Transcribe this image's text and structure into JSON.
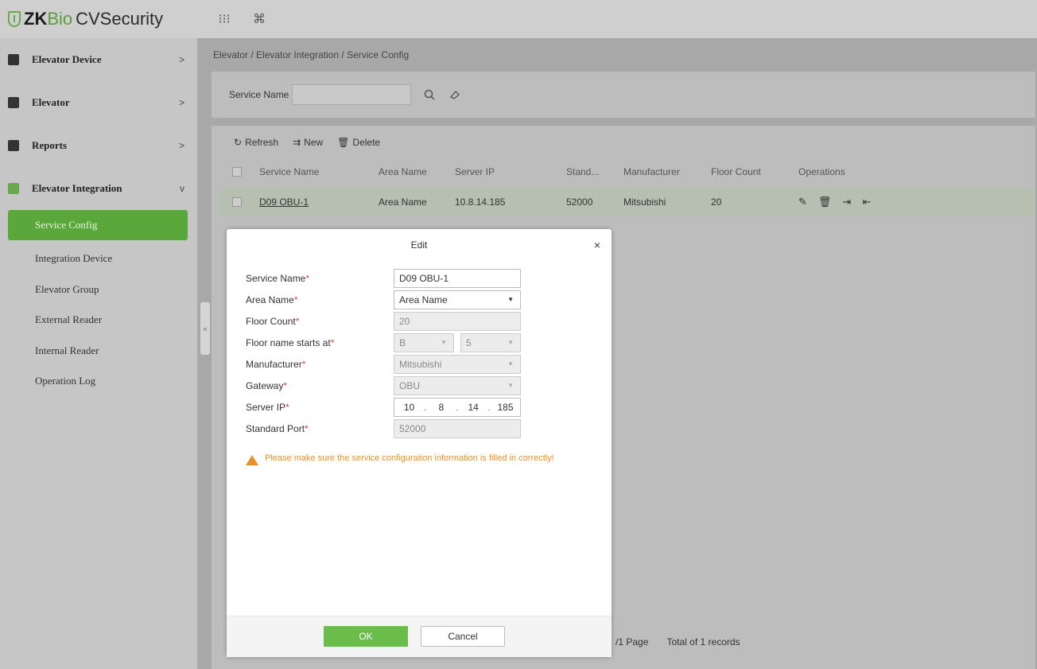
{
  "app": {
    "logo_zk": "ZK",
    "logo_bio": "Bio",
    "logo_rest": "CVSecurity",
    "top_icons": [
      "grid-icon",
      "command-icon"
    ]
  },
  "sidebar": {
    "items": [
      {
        "label": "Elevator Device",
        "icon": "elevator-device-icon",
        "chevron": ">"
      },
      {
        "label": "Elevator",
        "icon": "elevator-icon",
        "chevron": ">"
      },
      {
        "label": "Reports",
        "icon": "reports-icon",
        "chevron": ">"
      },
      {
        "label": "Elevator Integration",
        "icon": "elevator-integration-icon",
        "chevron": "v"
      }
    ],
    "subitems": [
      {
        "label": "Service Config",
        "active": true
      },
      {
        "label": "Integration Device"
      },
      {
        "label": "Elevator Group"
      },
      {
        "label": "External Reader"
      },
      {
        "label": "Internal Reader"
      },
      {
        "label": "Operation Log"
      }
    ],
    "collapse_glyph": "«"
  },
  "main": {
    "breadcrumb": "Elevator / Elevator Integration / Service Config",
    "search": {
      "label": "Service Name",
      "value": ""
    },
    "toolbar": {
      "refresh": "Refresh",
      "new": "New",
      "delete": "Delete"
    },
    "table": {
      "headers": [
        "Service Name",
        "Area Name",
        "Server IP",
        "Stand...",
        "Manufacturer",
        "Floor Count",
        "Operations"
      ],
      "rows": [
        {
          "service_name": "D09 OBU-1",
          "area_name": "Area Name",
          "server_ip": "10.8.14.185",
          "port": "52000",
          "manufacturer": "Mitsubishi",
          "floor_count": "20"
        }
      ]
    },
    "pager": {
      "page_text": "/1 Page",
      "total_text": "Total of 1 records"
    }
  },
  "dialog": {
    "title": "Edit",
    "close": "×",
    "fields": {
      "service_name": {
        "label": "Service Name",
        "value": "D09 OBU-1"
      },
      "area_name": {
        "label": "Area Name",
        "value": "Area Name"
      },
      "floor_count": {
        "label": "Floor Count",
        "value": "20"
      },
      "floor_start": {
        "label": "Floor name starts at",
        "prefix": "B",
        "number": "5"
      },
      "manufacturer": {
        "label": "Manufacturer",
        "value": "Mitsubishi"
      },
      "gateway": {
        "label": "Gateway",
        "value": "OBU"
      },
      "server_ip": {
        "label": "Server IP",
        "octets": [
          "10",
          "8",
          "14",
          "185"
        ]
      },
      "standard_port": {
        "label": "Standard Port",
        "value": "52000"
      }
    },
    "required_mark": "*",
    "warning": "Please make sure the service configuration information is filled in correctly!",
    "ok": "OK",
    "cancel": "Cancel"
  },
  "colors": {
    "accent_green": "#5aa83c",
    "warning_orange": "#e8912a",
    "required_red": "#e0453a"
  }
}
